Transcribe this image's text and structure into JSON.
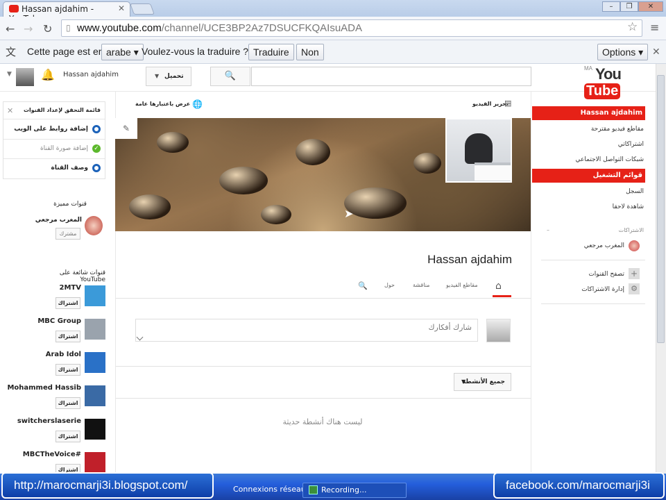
{
  "browser": {
    "tab_title": "Hassan ajdahim - YouTube",
    "url_domain": "www.youtube.com",
    "url_path": "/channel/UCE3BP2Az7DSUCFKQAIsuADA",
    "translate": {
      "prefix": "Cette page est en",
      "language": "arabe",
      "question": "Voulez-vous la traduire ?",
      "translate_btn": "Traduire",
      "no_btn": "Non",
      "options_btn": "Options"
    }
  },
  "yt_header": {
    "username": "Hassan ajdahim",
    "upload_label": "تحميل",
    "logo_you": "You",
    "logo_tube": "Tube",
    "logo_region": "MA"
  },
  "guide": {
    "selected": "Hassan ajdahim",
    "items": [
      "مقاطع فيديو مقترحة",
      "اشتراكاتي",
      "شبكات التواصل الاجتماعي"
    ],
    "playlists": "قوائم التشغيل",
    "items2": [
      "السجل",
      "شاهدة لاحقا"
    ],
    "subs_header": "الاشتراكات",
    "sub_channel": "المغرب مرجعي",
    "browse_channels": "تصفح القنوات",
    "manage_subs": "إدارة الاشتراكات"
  },
  "checklist": {
    "title": "قائمة التحقق لإعداد القنوات",
    "items": [
      {
        "label": "إضافة روابط على الويب",
        "done": false
      },
      {
        "label": "إضافة صورة القناة",
        "done": true
      },
      {
        "label": "وصف القناة",
        "done": false
      }
    ]
  },
  "featured": {
    "header": "قنوات مميزة",
    "channel": "المغرب مرجعي",
    "btn": "مشترك"
  },
  "popular": {
    "header": "قنوات شائعة على YouTube",
    "subscribe_label": "اشتراك",
    "channels": [
      "2MTV",
      "MBC Group",
      "Arab Idol",
      "Mohammed Hassib",
      "switcherslaserie",
      "MBCTheVoice#"
    ]
  },
  "channel": {
    "title": "Hassan ajdahim",
    "view_as_public": "عرض باعتبارها عامة",
    "edit_videos": "تحرير الفيديو",
    "tabs": [
      "مقاطع الفيديو",
      "مناقشة",
      "حول"
    ],
    "share_placeholder": "شارك أفكارك",
    "filter": "جميع الأنشطة",
    "no_activity": "ليست هناك أنشطة حديثة"
  },
  "overlay": {
    "left": "http://marocmarji3i.blogspot.com/",
    "right": "facebook.com/marocmarji3i",
    "task1": "Connexions réseau",
    "task2": "Recording..."
  }
}
